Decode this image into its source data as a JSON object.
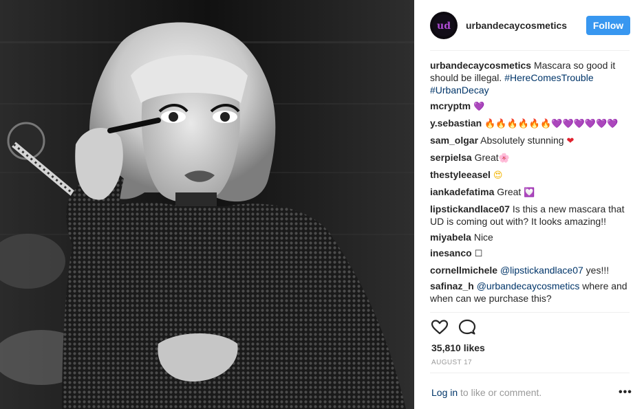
{
  "header": {
    "username": "urbandecaycosmetics",
    "follow_label": "Follow"
  },
  "caption": {
    "username": "urbandecaycosmetics",
    "text": "Mascara so good it should be illegal.",
    "hashtag1": "#HereComesTrouble",
    "hashtag2": "#UrbanDecay"
  },
  "comments": [
    {
      "user": "mcryptm",
      "text": ""
    },
    {
      "user": "y.sebastian",
      "text": ""
    },
    {
      "user": "sam_olgar",
      "text": "Absolutely stunning"
    },
    {
      "user": "serpielsa",
      "text": "Great"
    },
    {
      "user": "thestyleeasel",
      "text": ""
    },
    {
      "user": "iankadefatima",
      "text": "Great"
    },
    {
      "user": "lipstickandlace07",
      "text": "Is this a new mascara that UD is coming out with? It looks amazing!!"
    },
    {
      "user": "miyabela",
      "text": "Nice"
    },
    {
      "user": "inesanco",
      "text": ""
    },
    {
      "user": "cornellmichele",
      "mention": "@lipstickandlace07",
      "text": "yes!!!"
    },
    {
      "user": "safinaz_h",
      "mention": "@urbandecaycosmetics",
      "text": "where and when can we purchase this?"
    }
  ],
  "emoji": {
    "heart_purple": "💜",
    "flame": "🔥",
    "heart_red": "❤",
    "blossom": "🌸",
    "heart_eyes": "😍",
    "heart_gift": "💟",
    "box": "☐"
  },
  "stats": {
    "likes": "35,810 likes",
    "date": "AUGUST 17"
  },
  "footer": {
    "login_link": "Log in",
    "login_rest": "to like or comment.",
    "more": "•••"
  },
  "icons": {
    "like": "heart-outline-icon",
    "comment": "speech-bubble-icon",
    "more": "ellipsis-icon"
  },
  "colors": {
    "accent": "#3897f0",
    "link": "#003569",
    "muted": "#999999",
    "text": "#262626"
  }
}
